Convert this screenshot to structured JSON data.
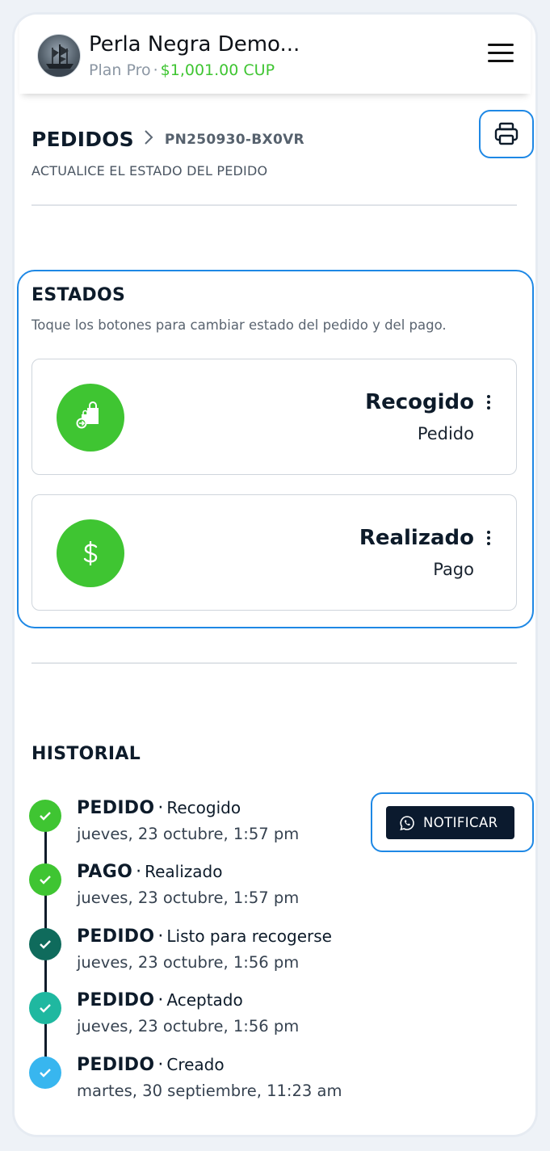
{
  "header": {
    "app_title": "Perla Negra Demo...",
    "plan": "Plan Pro",
    "separator": "·",
    "balance": "$1,001.00 CUP",
    "menu_icon": "hamburger-icon",
    "avatar_icon": "pirate-ship-avatar"
  },
  "page": {
    "title": "PEDIDOS",
    "breadcrumb_sep": ">",
    "order_code": "PN250930-BX0VR",
    "subtitle": "ACTUALICE EL ESTADO DEL PEDIDO",
    "print_icon": "printer-icon"
  },
  "estados": {
    "title": "ESTADOS",
    "description": "Toque los botones para cambiar estado del pedido y del pago.",
    "cards": [
      {
        "label": "Recogido",
        "type": "Pedido",
        "icon": "shopping-bags-icon",
        "color": "#3fc532"
      },
      {
        "label": "Realizado",
        "type": "Pago",
        "icon": "dollar-icon",
        "color": "#3fc532"
      }
    ]
  },
  "historial": {
    "title": "HISTORIAL",
    "notify_label": "NOTIFICAR",
    "notify_icon": "whatsapp-icon",
    "mid_dot": "·",
    "items": [
      {
        "kind": "PEDIDO",
        "status": "Recogido",
        "date": "jueves, 23 octubre, 1:57 pm",
        "color": "#3fc532"
      },
      {
        "kind": "PAGO",
        "status": "Realizado",
        "date": "jueves, 23 octubre, 1:57 pm",
        "color": "#3fc532"
      },
      {
        "kind": "PEDIDO",
        "status": "Listo para recogerse",
        "date": "jueves, 23 octubre, 1:56 pm",
        "color": "#0f6b5c"
      },
      {
        "kind": "PEDIDO",
        "status": "Aceptado",
        "date": "jueves, 23 octubre, 1:56 pm",
        "color": "#1fb8a0"
      },
      {
        "kind": "PEDIDO",
        "status": "Creado",
        "date": "martes, 30 septiembre, 11:23 am",
        "color": "#38b6ef"
      }
    ]
  }
}
